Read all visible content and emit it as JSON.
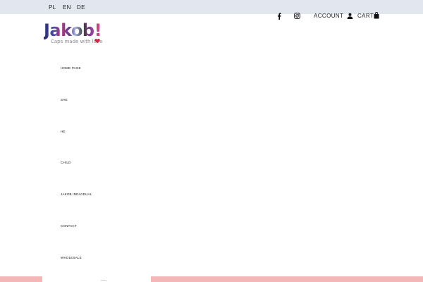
{
  "header": {
    "languages": [
      "PL",
      "EN",
      "DE"
    ],
    "account_label": "ACCOUNT",
    "cart_label": "CART"
  },
  "logo": {
    "wordmark": "Jakob!",
    "tagline": "Caps made with love"
  },
  "nav": {
    "items": [
      "HOME PAGE",
      "SHE",
      "HE",
      "CHILD",
      "JAKOB INDIVIDUAL",
      "CONTACT",
      "WHOLESALE"
    ]
  },
  "colors": {
    "topbar_bg": "#e2e6ef",
    "bottom_strip": "#f4b7b7",
    "heart": "#d12a4a"
  },
  "icons": {
    "facebook": "facebook-icon",
    "instagram": "instagram-icon",
    "account": "user-icon",
    "cart": "shopping-bag-icon",
    "heart": "heart-icon"
  }
}
